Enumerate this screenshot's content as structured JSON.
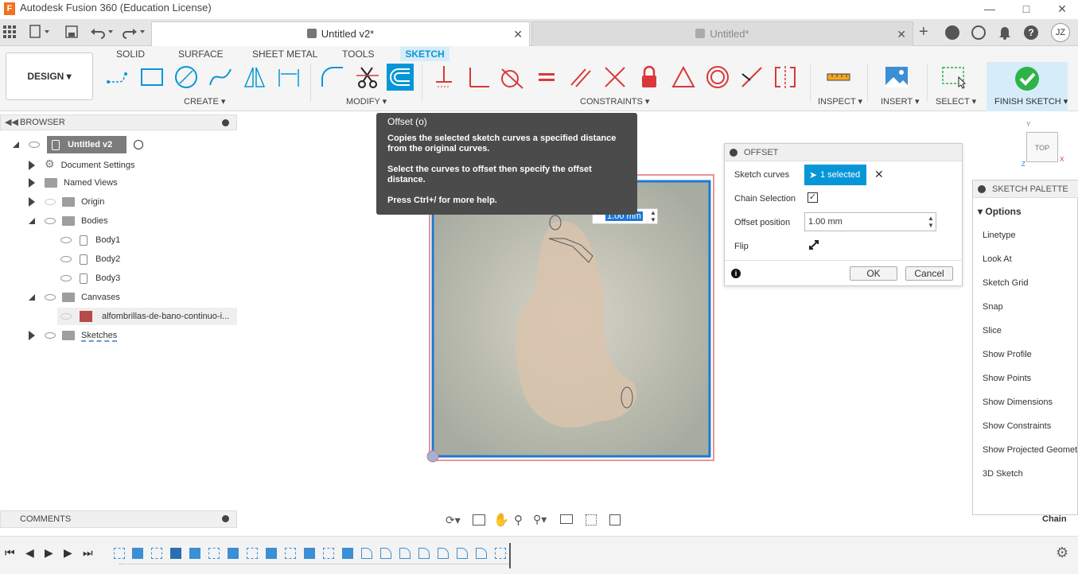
{
  "app": {
    "title": "Autodesk Fusion 360 (Education License)",
    "icon_letter": "F"
  },
  "window_controls": [
    "minimize-icon",
    "maximize-icon",
    "close-icon"
  ],
  "tabs": [
    {
      "label": "Untitled v2*",
      "active": true
    },
    {
      "label": "Untitled*",
      "active": false
    }
  ],
  "user_initials": "JZ",
  "toolbar": {
    "workspace": "DESIGN",
    "tabs": [
      "SOLID",
      "SURFACE",
      "SHEET METAL",
      "TOOLS",
      "SKETCH"
    ],
    "active_tab": "SKETCH",
    "groups": [
      "CREATE",
      "MODIFY",
      "CONSTRAINTS",
      "INSPECT",
      "INSERT",
      "SELECT",
      "FINISH SKETCH"
    ]
  },
  "browser": {
    "title": "BROWSER",
    "root": "Untitled v2",
    "nodes": [
      {
        "label": "Document Settings"
      },
      {
        "label": "Named Views"
      },
      {
        "label": "Origin"
      },
      {
        "label": "Bodies"
      },
      {
        "label": "Body1"
      },
      {
        "label": "Body2"
      },
      {
        "label": "Body3"
      },
      {
        "label": "Canvases"
      },
      {
        "label": "alfombrillas-de-bano-continuo-i..."
      },
      {
        "label": "Sketches"
      }
    ]
  },
  "comments": {
    "title": "COMMENTS"
  },
  "tooltip": {
    "title": "Offset (o)",
    "line1": "Copies the selected sketch curves a specified distance from the original curves.",
    "line2": "Select the curves to offset then specify the offset distance.",
    "line3": "Press Ctrl+/ for more help."
  },
  "canvas": {
    "dimension_value": "1.00 mm",
    "view_cube_label": "TOP",
    "axis_labels": [
      "Y",
      "X",
      "Z"
    ]
  },
  "offset_dialog": {
    "title": "OFFSET",
    "sketch_curves_label": "Sketch curves",
    "selected_text": "1 selected",
    "chain_selection_label": "Chain Selection",
    "chain_checked": true,
    "offset_position_label": "Offset position",
    "offset_value": "1.00 mm",
    "flip_label": "Flip",
    "ok": "OK",
    "cancel": "Cancel"
  },
  "palette": {
    "title": "SKETCH PALETTE",
    "section": "Options",
    "items": [
      "Linetype",
      "Look At",
      "Sketch Grid",
      "Snap",
      "Slice",
      "Show Profile",
      "Show Points",
      "Show Dimensions",
      "Show Constraints",
      "Show Projected Geometries",
      "3D Sketch"
    ]
  },
  "status_text": "Chain",
  "colors": {
    "accent": "#0696d7",
    "sketch_tab_bg": "#d6ecf9",
    "constraint_red": "#d9383a",
    "finish_green": "#2db34a"
  }
}
